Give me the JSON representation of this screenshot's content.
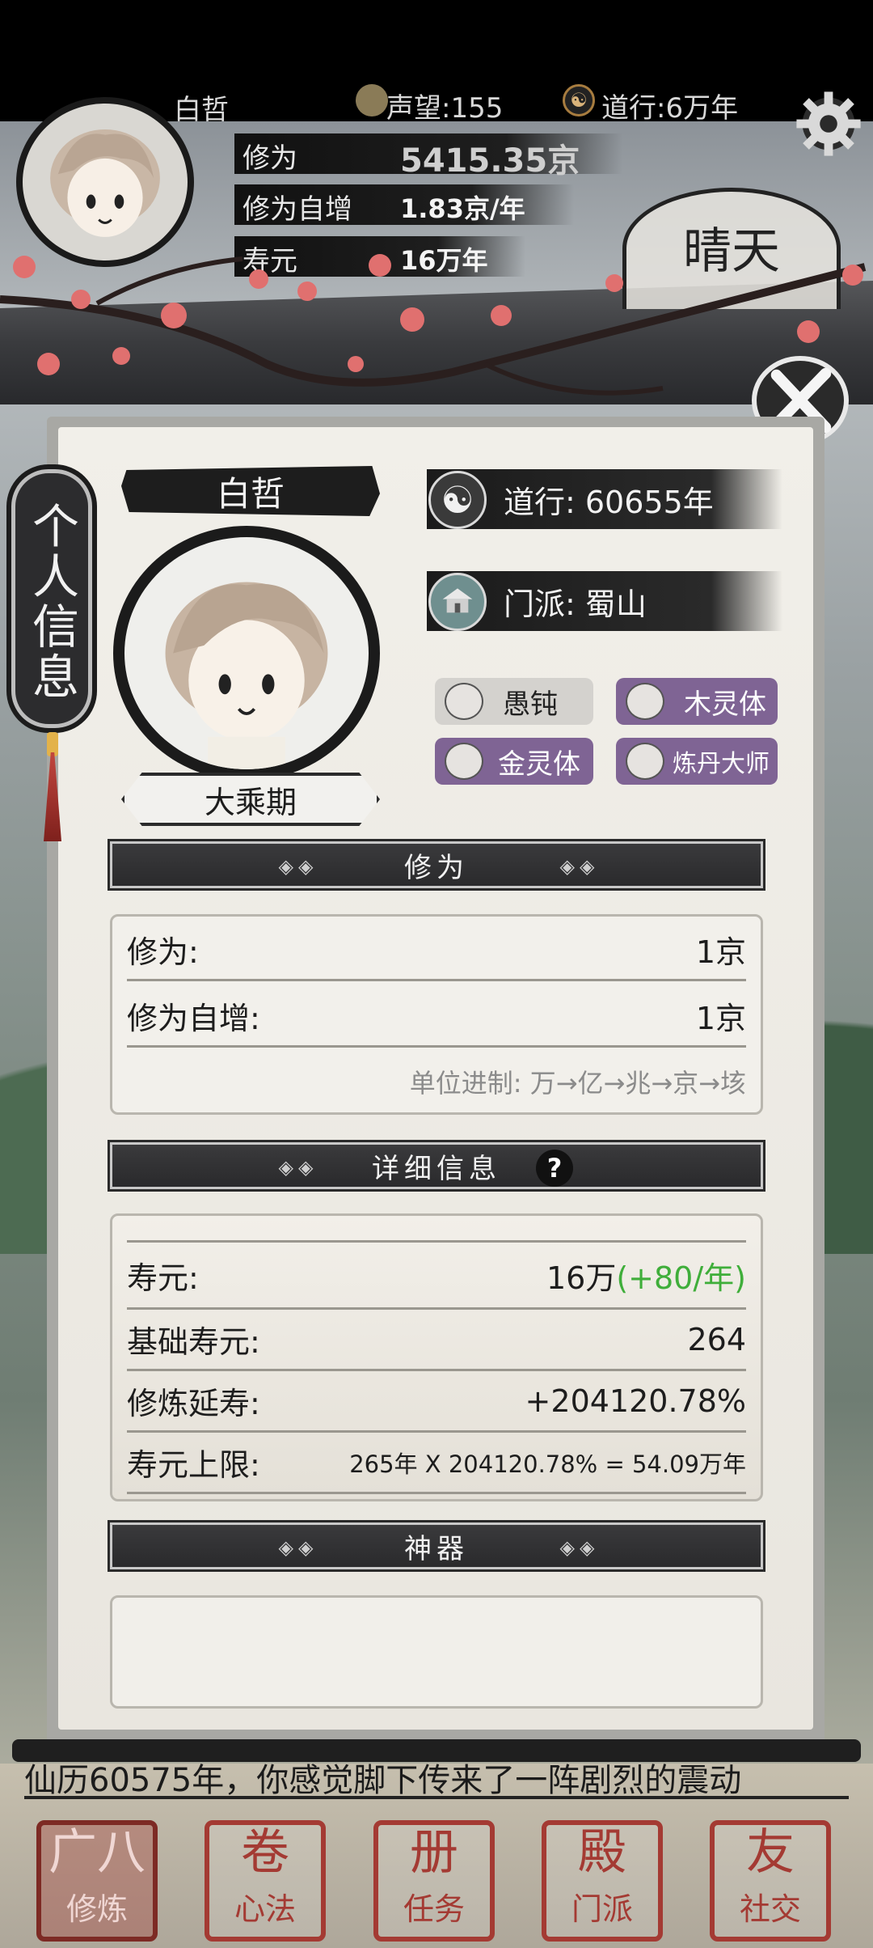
{
  "hud": {
    "player_name": "白哲",
    "reputation": "声望:155",
    "daoxing": "道行:6万年",
    "cultivation_label": "修为",
    "cultivation_value": "5415.35京",
    "cult_increase_label": "修为自增",
    "cult_increase_value": "1.83京/年",
    "lifespan_label": "寿元",
    "lifespan_value": "16万年",
    "weather": "晴天"
  },
  "side_tab": {
    "label": "个人信息"
  },
  "profile": {
    "name": "白哲",
    "realm": "大乘期",
    "daoxing": "道行: 60655年",
    "sect": "门派: 蜀山",
    "traits": [
      {
        "label": "愚钝",
        "style": "gray"
      },
      {
        "label": "木灵体",
        "style": "purple"
      },
      {
        "label": "金灵体",
        "style": "purple"
      },
      {
        "label": "炼丹大师",
        "style": "purple"
      }
    ]
  },
  "cultivation_section": {
    "title": "修为",
    "rows": [
      {
        "label": "修为:",
        "value": "1京"
      },
      {
        "label": "修为自增:",
        "value": "1京"
      }
    ],
    "unit_note": "单位进制: 万→亿→兆→京→垓"
  },
  "detail_section": {
    "title": "详细信息",
    "help": "?",
    "rows": [
      {
        "label": "寿元:",
        "value": "16万",
        "extra": "(+80/年)"
      },
      {
        "label": "基础寿元:",
        "value": "264"
      },
      {
        "label": "修炼延寿:",
        "value": "+204120.78%"
      },
      {
        "label": "寿元上限:",
        "value": "265年 X 204120.78% = 54.09万年"
      }
    ]
  },
  "artifact_section": {
    "title": "神器"
  },
  "news_ticker": "仙历60575年，你感觉脚下传来了一阵剧烈的震动",
  "nav": [
    {
      "label": "修炼",
      "glyph": "广八"
    },
    {
      "label": "心法",
      "glyph": "卷"
    },
    {
      "label": "任务",
      "glyph": "册"
    },
    {
      "label": "门派",
      "glyph": "殿"
    },
    {
      "label": "社交",
      "glyph": "友"
    }
  ],
  "colors": {
    "accent_red": "#a43a33",
    "trait_purple": "#7f6494",
    "green": "#3fae3a"
  }
}
